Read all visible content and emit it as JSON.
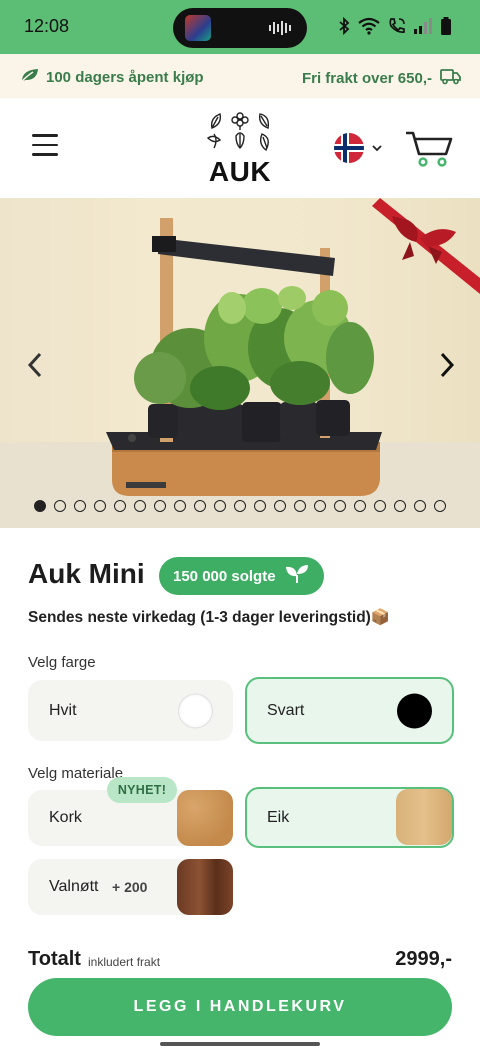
{
  "status_bar": {
    "time": "12:08"
  },
  "promo": {
    "left_text": "100 dagers åpent kjøp",
    "right_text": "Fri frakt over 650,-"
  },
  "header": {
    "logo_text": "AUK"
  },
  "product": {
    "title": "Auk Mini",
    "sold_badge": "150 000 solgte",
    "shipping": "Sendes neste virkedag (1-3 dager leveringstid)📦",
    "carousel": {
      "slide_count": 21,
      "active_index": 0
    }
  },
  "color_section": {
    "label": "Velg farge",
    "options": [
      {
        "label": "Hvit",
        "swatch": "#ffffff",
        "selected": false
      },
      {
        "label": "Svart",
        "swatch": "#000000",
        "selected": true
      }
    ]
  },
  "material_section": {
    "label": "Velg materiale",
    "options": [
      {
        "label": "Kork",
        "badge": "NYHET!",
        "selected": false
      },
      {
        "label": "Eik",
        "selected": true
      },
      {
        "label": "Valnøtt",
        "price_add": "+ 200",
        "selected": false
      }
    ]
  },
  "total": {
    "label": "Totalt",
    "sub": "inkludert frakt",
    "price": "2999,-"
  },
  "cta": {
    "label": "LEGG I HANDLEKURV"
  },
  "colors": {
    "brand_green": "#45b56b",
    "header_green": "#5cbd74",
    "promo_bg": "#fbf5e9"
  }
}
